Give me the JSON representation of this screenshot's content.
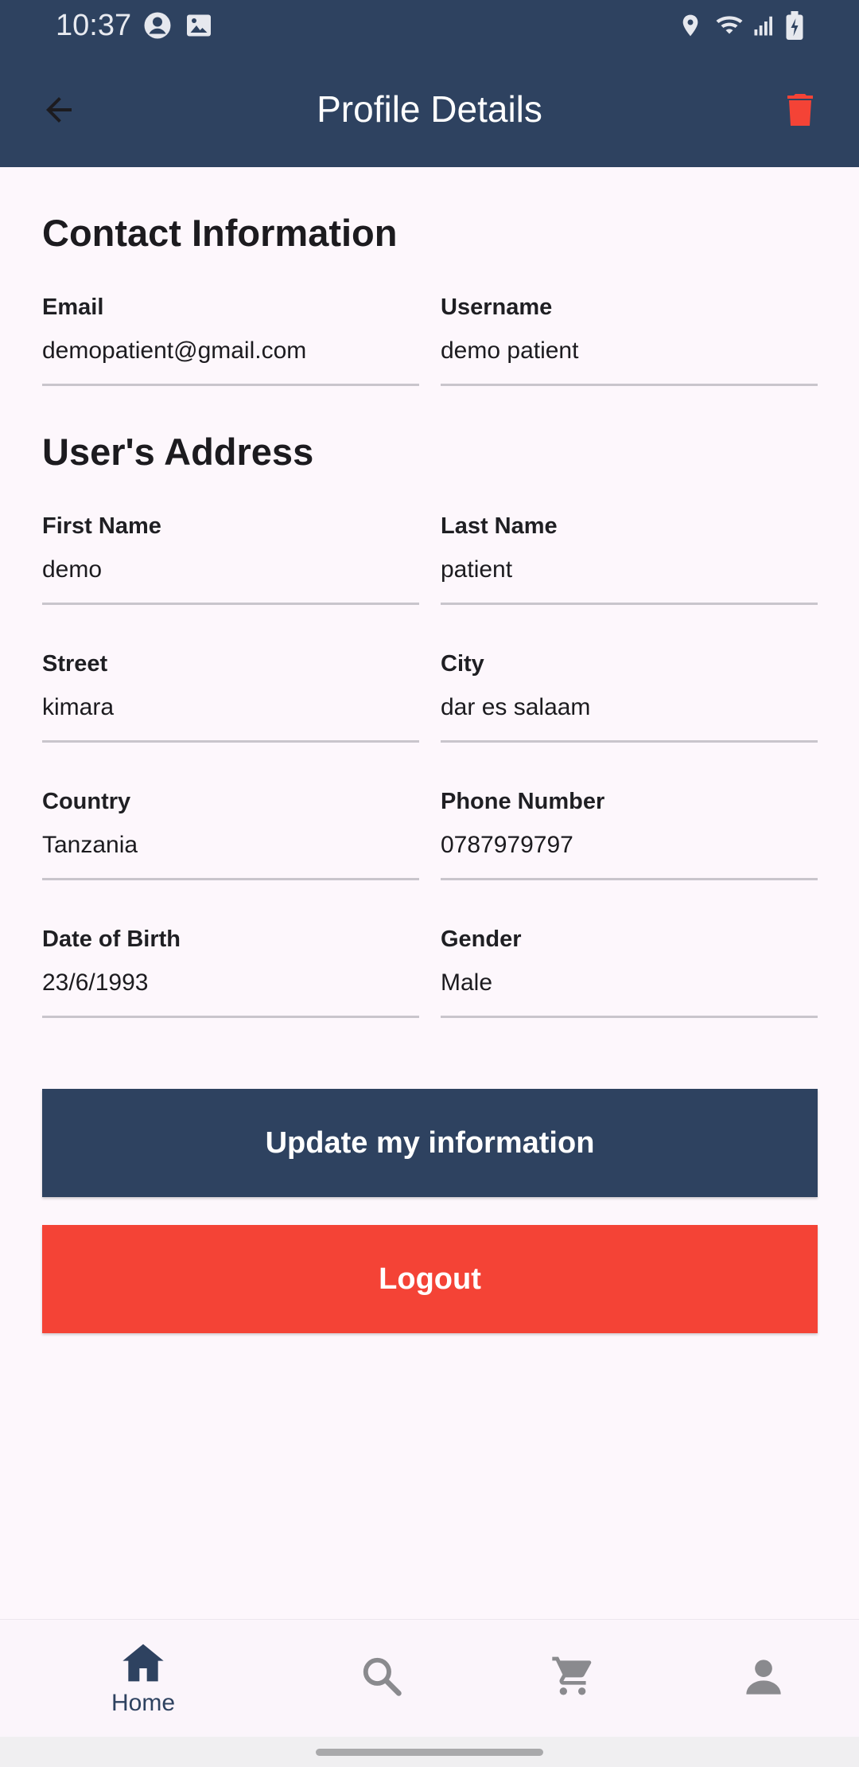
{
  "status_bar": {
    "time": "10:37",
    "icons": [
      "account-circle-icon",
      "image-icon",
      "location-icon",
      "wifi-icon",
      "signal-icon",
      "battery-charging-icon"
    ]
  },
  "app_bar": {
    "title": "Profile Details",
    "back_icon": "arrow-back-icon",
    "delete_icon": "trash-icon",
    "delete_color": "#f44336",
    "background": "#2e4260"
  },
  "contact": {
    "title": "Contact Information",
    "email": {
      "label": "Email",
      "value": "demopatient@gmail.com"
    },
    "username": {
      "label": "Username",
      "value": "demo patient"
    }
  },
  "address": {
    "title": "User's Address",
    "first_name": {
      "label": "First Name",
      "value": "demo"
    },
    "last_name": {
      "label": "Last Name",
      "value": "patient"
    },
    "street": {
      "label": "Street",
      "value": "kimara"
    },
    "city": {
      "label": "City",
      "value": "dar es salaam"
    },
    "country": {
      "label": "Country",
      "value": "Tanzania"
    },
    "phone": {
      "label": "Phone Number",
      "value": "0787979797"
    },
    "dob": {
      "label": "Date of Birth",
      "value": "23/6/1993"
    },
    "gender": {
      "label": "Gender",
      "value": "Male"
    }
  },
  "actions": {
    "update_label": "Update my information",
    "update_color": "#2e4260",
    "logout_label": "Logout",
    "logout_color": "#f44336"
  },
  "bottom_nav": {
    "items": [
      {
        "icon": "home-icon",
        "label": "Home",
        "active": true
      },
      {
        "icon": "search-icon",
        "label": ""
      },
      {
        "icon": "cart-icon",
        "label": ""
      },
      {
        "icon": "person-icon",
        "label": ""
      }
    ]
  }
}
